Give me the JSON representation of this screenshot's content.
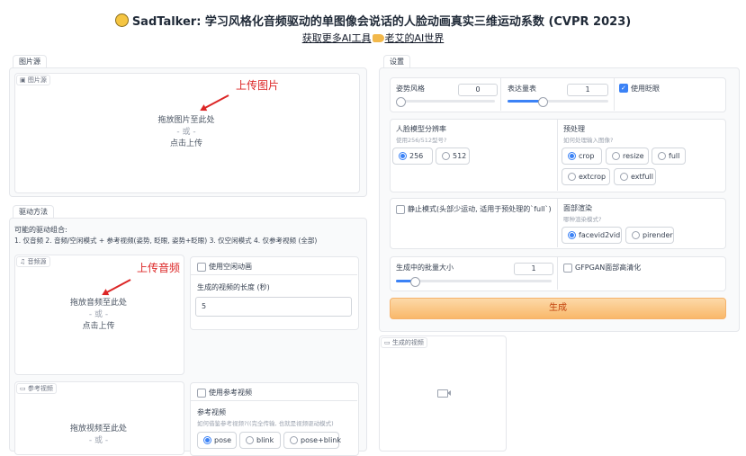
{
  "header": {
    "title": "SadTalker: 学习风格化音频驱动的单图像会说话的人脸动画真实三维运动系数 (CVPR 2023)",
    "subtitle_before": "获取更多AI工具",
    "subtitle_after": "老艾的AI世界"
  },
  "image_source": {
    "tab": "图片源",
    "label": "图片源",
    "drop": "拖放图片至此处",
    "or": "- 或 -",
    "click": "点击上传",
    "annotation": "上传图片"
  },
  "driving": {
    "tab": "驱动方法",
    "desc1": "可能的驱动组合:",
    "desc2": "1. 仅音频 2. 音频/空闲模式 + 参考视频(姿势, 眨眼, 姿势+眨眼) 3. 仅空闲模式 4. 仅参考视频 (全部)",
    "audio_label": "音频源",
    "audio_drop": "拖放音频至此处",
    "audio_or": "- 或 -",
    "audio_click": "点击上传",
    "audio_annotation": "上传音频",
    "idle_checkbox": "使用空闲动画",
    "video_length_label": "生成的视频的长度 (秒)",
    "video_length_value": "5",
    "ref_label": "参考视频",
    "ref_drop": "拖放视频至此处",
    "ref_or": "- 或 -",
    "use_ref_checkbox": "使用参考视频",
    "ref_title": "参考视频",
    "ref_hint": "如何借鉴参考视频?((完全传输, 也就是视频驱动模式)",
    "ref_options": [
      "pose",
      "blink",
      "pose+blink"
    ],
    "ref_selected": "pose"
  },
  "settings": {
    "tab": "设置",
    "pose_style_label": "姿势风格",
    "pose_style_value": "0",
    "expression_label": "表达量表",
    "expression_value": "1",
    "blink_label": "使用眨眼",
    "blink_checked": true,
    "face_res_label": "人脸模型分辨率",
    "face_res_hint": "使用256/512型号?",
    "face_res_options": [
      "256",
      "512"
    ],
    "face_res_selected": "256",
    "preprocess_label": "预处理",
    "preprocess_hint": "如何处理输入图像?",
    "preprocess_options": [
      "crop",
      "resize",
      "full",
      "extcrop",
      "extfull"
    ],
    "preprocess_selected": "crop",
    "still_label": "静止模式(头部少运动, 适用于预处理的`full`)",
    "renderer_label": "面部渲染",
    "renderer_hint": "哪种渲染模式?",
    "renderer_options": [
      "facevid2vid",
      "pirender"
    ],
    "renderer_selected": "facevid2vid",
    "batch_label": "生成中的批量大小",
    "batch_value": "1",
    "gfpgan_label": "GFPGAN面部高清化",
    "generate_button": "生成",
    "output_label": "生成的视频"
  },
  "colors": {
    "accent": "#3b82f6",
    "annotation": "#dc2626",
    "generate": "#f9b86a"
  },
  "icons": {
    "image": "image-icon",
    "audio": "music-icon",
    "video": "video-camera-icon"
  }
}
